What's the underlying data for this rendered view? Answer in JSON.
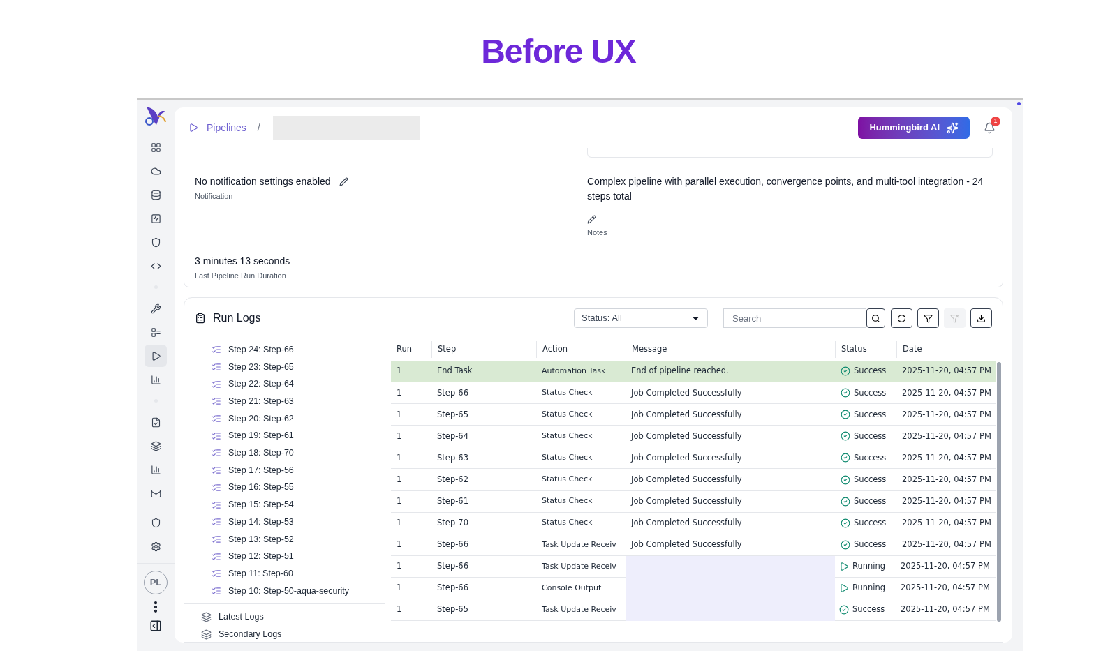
{
  "page_title": "Before UX",
  "sidebar": {
    "groups": [
      {
        "items": [
          {
            "selected": false
          },
          {
            "selected": false
          },
          {
            "selected": false
          },
          {
            "selected": false
          },
          {
            "selected": false
          },
          {
            "selected": false
          }
        ]
      },
      {
        "items": [
          {
            "selected": false
          },
          {
            "selected": false
          },
          {
            "selected": true
          },
          {
            "selected": false
          }
        ]
      },
      {
        "items": [
          {
            "selected": false
          },
          {
            "selected": false
          },
          {
            "selected": false
          },
          {
            "selected": false
          }
        ]
      },
      {
        "items": [
          {
            "selected": false
          },
          {
            "selected": false
          }
        ]
      }
    ],
    "avatar": "PL"
  },
  "header": {
    "breadcrumb": "Pipelines",
    "separator": "/",
    "ai_button": "Hummingbird AI",
    "notification_count": "1"
  },
  "details": {
    "notification": {
      "value": "No notification settings enabled",
      "label": "Notification"
    },
    "duration": {
      "value": "3 minutes 13 seconds",
      "label": "Last Pipeline Run Duration"
    },
    "notes": {
      "value": "Complex pipeline with parallel execution, convergence points, and multi-tool integration - 24 steps total",
      "label": "Notes"
    }
  },
  "run_logs": {
    "title": "Run Logs",
    "status_filter": "Status: All",
    "search": {
      "placeholder": "Search"
    },
    "steps": [
      "Step 24: Step-66",
      "Step 23: Step-65",
      "Step 22: Step-64",
      "Step 21: Step-63",
      "Step 20: Step-62",
      "Step 19: Step-61",
      "Step 18: Step-70",
      "Step 17: Step-56",
      "Step 16: Step-55",
      "Step 15: Step-54",
      "Step 14: Step-53",
      "Step 13: Step-52",
      "Step 12: Step-51",
      "Step 11: Step-60",
      "Step 10: Step-50-aqua-security"
    ],
    "log_sources": [
      "Latest Logs",
      "Secondary Logs"
    ],
    "table": {
      "columns": [
        "Run",
        "Step",
        "Action",
        "Message",
        "Status",
        "Date"
      ],
      "rows": [
        {
          "selected": true,
          "run": "1",
          "step": "End Task",
          "action": "Automation Task",
          "message": "End of pipeline reached.",
          "status": {
            "kind": "success",
            "label": "Success"
          },
          "date": "2025-11-20, 04:57 PM"
        },
        {
          "selected": false,
          "run": "1",
          "step": "Step-66",
          "action": "Status Check",
          "message": "Job Completed Successfully",
          "status": {
            "kind": "success",
            "label": "Success"
          },
          "date": "2025-11-20, 04:57 PM"
        },
        {
          "selected": false,
          "run": "1",
          "step": "Step-65",
          "action": "Status Check",
          "message": "Job Completed Successfully",
          "status": {
            "kind": "success",
            "label": "Success"
          },
          "date": "2025-11-20, 04:57 PM"
        },
        {
          "selected": false,
          "run": "1",
          "step": "Step-64",
          "action": "Status Check",
          "message": "Job Completed Successfully",
          "status": {
            "kind": "success",
            "label": "Success"
          },
          "date": "2025-11-20, 04:57 PM"
        },
        {
          "selected": false,
          "run": "1",
          "step": "Step-63",
          "action": "Status Check",
          "message": "Job Completed Successfully",
          "status": {
            "kind": "success",
            "label": "Success"
          },
          "date": "2025-11-20, 04:57 PM"
        },
        {
          "selected": false,
          "run": "1",
          "step": "Step-62",
          "action": "Status Check",
          "message": "Job Completed Successfully",
          "status": {
            "kind": "success",
            "label": "Success"
          },
          "date": "2025-11-20, 04:57 PM"
        },
        {
          "selected": false,
          "run": "1",
          "step": "Step-61",
          "action": "Status Check",
          "message": "Job Completed Successfully",
          "status": {
            "kind": "success",
            "label": "Success"
          },
          "date": "2025-11-20, 04:57 PM"
        },
        {
          "selected": false,
          "run": "1",
          "step": "Step-70",
          "action": "Status Check",
          "message": "Job Completed Successfully",
          "status": {
            "kind": "success",
            "label": "Success"
          },
          "date": "2025-11-20, 04:57 PM"
        },
        {
          "selected": false,
          "run": "1",
          "step": "Step-66",
          "action": "Task Update Receiv",
          "message": "Job Completed Successfully",
          "status": {
            "kind": "success",
            "label": "Success"
          },
          "date": "2025-11-20, 04:57 PM"
        },
        {
          "selected": false,
          "run": "1",
          "step": "Step-66",
          "action": "Task Update Receiv",
          "message_hidden": true,
          "status": {
            "kind": "running",
            "label": "Running"
          },
          "date": "2025-11-20, 04:57 PM"
        },
        {
          "selected": false,
          "run": "1",
          "step": "Step-66",
          "action": "Console Output",
          "message_hidden": true,
          "status": {
            "kind": "running",
            "label": "Running"
          },
          "date": "2025-11-20, 04:57 PM"
        },
        {
          "selected": false,
          "run": "1",
          "step": "Step-65",
          "action": "Task Update Receiv",
          "message_hidden": true,
          "status": {
            "kind": "success",
            "label": "Success"
          },
          "date": "2025-11-20, 04:57 PM"
        }
      ]
    }
  }
}
